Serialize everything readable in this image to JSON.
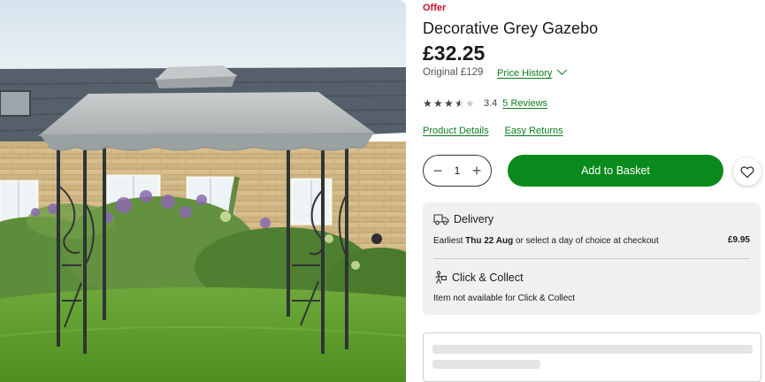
{
  "product": {
    "offer_label": "Offer",
    "title": "Decorative Grey Gazebo",
    "price": "£32.25",
    "original_price": "Original £129",
    "price_history_label": "Price History"
  },
  "rating": {
    "stars_filled": 3.5,
    "stars_total": 5,
    "value": "3.4",
    "reviews_label": "5 Reviews"
  },
  "links": {
    "product_details": "Product Details",
    "easy_returns": "Easy Returns"
  },
  "purchase": {
    "quantity": "1",
    "add_to_basket": "Add to Basket"
  },
  "delivery": {
    "title": "Delivery",
    "text_prefix": "Earliest ",
    "date": "Thu 22 Aug",
    "text_suffix": " or select a day of choice at checkout",
    "price": "£9.95"
  },
  "click_collect": {
    "title": "Click & Collect",
    "text": "Item not available for Click & Collect"
  },
  "colors": {
    "offer": "#c8102e",
    "accent_green": "#0a8a1c",
    "panel_bg": "#f0f0f1"
  },
  "icons": [
    "chevron-down-icon",
    "star-icon",
    "heart-icon",
    "delivery-van-icon",
    "click-collect-icon",
    "plus-icon",
    "minus-icon"
  ]
}
